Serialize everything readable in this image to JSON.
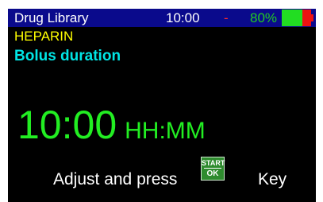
{
  "status_bar": {
    "title": "Drug Library",
    "time": "10:00",
    "separator": "-",
    "battery_percent": "80%",
    "battery_level": 0.8
  },
  "drug": {
    "name": "HEPARIN"
  },
  "screen": {
    "title": "Bolus duration"
  },
  "value": {
    "time": "10:00",
    "unit": "HH:MM"
  },
  "prompt": {
    "text": "Adjust and press",
    "key_line1": "START",
    "key_line2": "OK",
    "suffix": "Key"
  },
  "colors": {
    "background": "#000000",
    "status_bar": "#0a0a8c",
    "drug_name": "#ffff00",
    "title": "#00e5e5",
    "value": "#22ee22",
    "battery_ok": "#22dd22",
    "battery_low": "#ee1111"
  },
  "icons": {
    "battery": "battery-icon",
    "start_ok_key": "start-ok-key-icon"
  }
}
